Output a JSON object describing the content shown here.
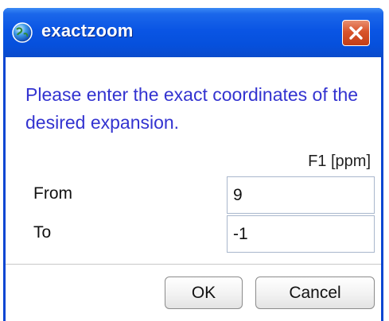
{
  "window": {
    "title": "exactzoom",
    "icon": "globe-icon",
    "close_icon": "close-icon"
  },
  "dialog": {
    "prompt": "Please enter the exact coordinates of the desired expansion.",
    "column_header": "F1 [ppm]",
    "rows": [
      {
        "label": "From",
        "value": "9"
      },
      {
        "label": "To",
        "value": "-1"
      }
    ]
  },
  "buttons": {
    "ok_label": "OK",
    "cancel_label": "Cancel"
  },
  "colors": {
    "titlebar": "#0a55e4",
    "prompt_text": "#3333d0",
    "close_button": "#d8542b"
  }
}
